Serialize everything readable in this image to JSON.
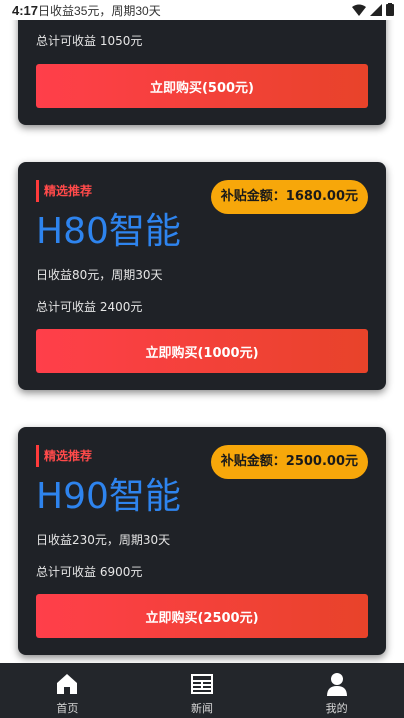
{
  "status_bar": {
    "time": "4:17",
    "notification": "日收益35元，周期30天"
  },
  "cards": [
    {
      "total_text": "总计可收益 1050元",
      "button_label": "立即购买(500元)"
    },
    {
      "tag": "精选推荐",
      "subsidy": "补贴金额：1680.00元",
      "name": "H80智能",
      "daily_text": "日收益80元，周期30天",
      "total_text": "总计可收益 2400元",
      "button_label": "立即购买(1000元)"
    },
    {
      "tag": "精选推荐",
      "subsidy": "补贴金额：2500.00元",
      "name": "H90智能",
      "daily_text": "日收益230元，周期30天",
      "total_text": "总计可收益 6900元",
      "button_label": "立即购买(2500元)"
    }
  ],
  "nav": [
    {
      "label": "首页",
      "icon": "home-icon"
    },
    {
      "label": "新闻",
      "icon": "news-icon"
    },
    {
      "label": "我的",
      "icon": "user-icon"
    }
  ],
  "colors": {
    "card_bg": "#1f2227",
    "accent_red": "#ff3f4a",
    "subsidy_orange": "#f7a70a",
    "product_blue": "#2e84ee",
    "nav_bg": "#23262b"
  }
}
